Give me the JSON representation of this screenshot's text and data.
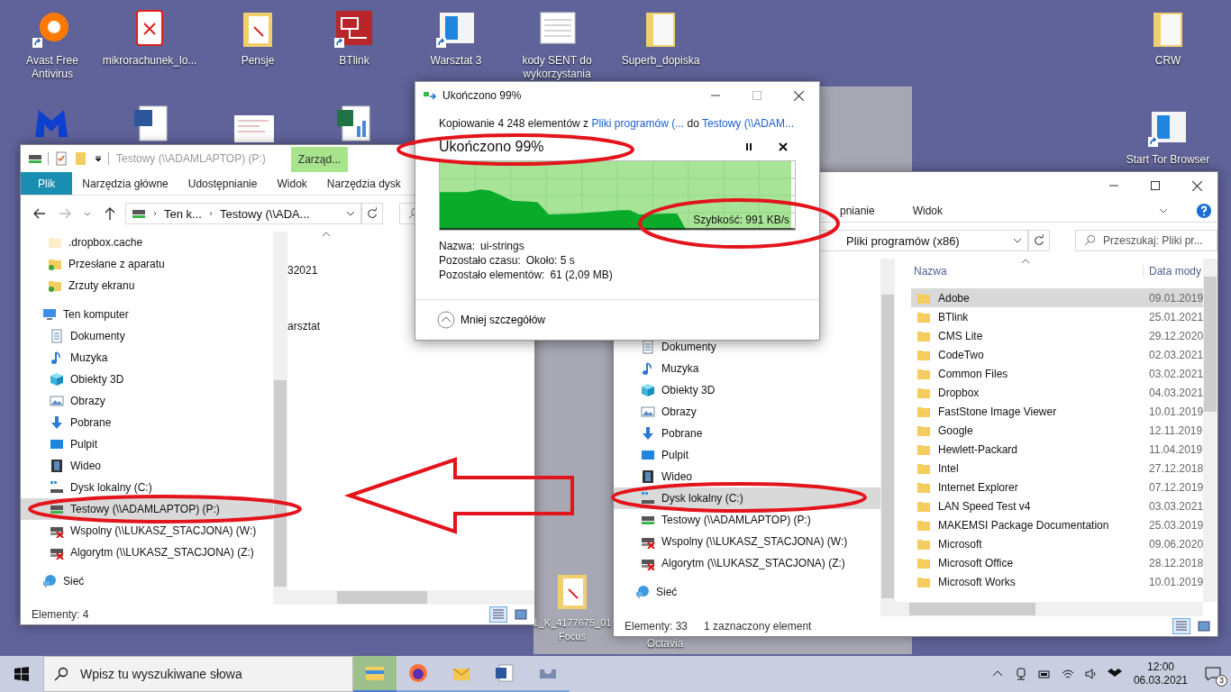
{
  "desktop": {
    "icons": [
      {
        "label": "Avast Free Antivirus",
        "kind": "avast",
        "shortcut": true
      },
      {
        "label": "mikrorachunek_lo...",
        "kind": "pdf",
        "shortcut": false
      },
      {
        "label": "Pensje",
        "kind": "pdf-folder",
        "shortcut": false
      },
      {
        "label": "BTlink",
        "kind": "app",
        "shortcut": true
      },
      {
        "label": "Warsztat 3",
        "kind": "window",
        "shortcut": true
      },
      {
        "label": "kody SENT do wykorzystania",
        "kind": "document",
        "shortcut": false
      },
      {
        "label": "Superb_dopiska",
        "kind": "folder",
        "shortcut": false
      },
      {
        "label": "CRW",
        "kind": "folder",
        "shortcut": false
      },
      {
        "label": "Start Tor Browser",
        "kind": "window",
        "shortcut": true
      },
      {
        "label": "1_K_4177675_01 Focus",
        "kind": "pdf-folder",
        "shortcut": false
      },
      {
        "label": "Octavia",
        "kind": "none"
      }
    ]
  },
  "left_explorer": {
    "title": "Testowy (\\\\ADAMLAPTOP) (P:)",
    "context_tab": "Zarząd...",
    "ribbon_tabs": [
      {
        "label": "Plik",
        "selected": true
      },
      {
        "label": "Narzędzia główne",
        "selected": false
      },
      {
        "label": "Udostępnianie",
        "selected": false
      },
      {
        "label": "Widok",
        "selected": false
      },
      {
        "label": "Narzędzia dysk",
        "selected": false
      }
    ],
    "breadcrumb": [
      "Ten k...",
      "Testowy (\\\\ADA..."
    ],
    "nav_tree": [
      {
        "children": [
          {
            "label": ".dropbox.cache",
            "kind": "folder-plain",
            "selected": false
          },
          {
            "label": "Przesłane z aparatu",
            "kind": "folder-synced",
            "selected": false
          },
          {
            "label": "Zrzuty ekranu",
            "kind": "folder-synced",
            "selected": false
          }
        ]
      },
      {
        "label": "Ten komputer",
        "kind": "pc",
        "selected": false,
        "children": [
          {
            "label": "Dokumenty",
            "kind": "documents",
            "selected": false
          },
          {
            "label": "Muzyka",
            "kind": "music",
            "selected": false
          },
          {
            "label": "Obiekty 3D",
            "kind": "cube",
            "selected": false
          },
          {
            "label": "Obrazy",
            "kind": "pictures",
            "selected": false
          },
          {
            "label": "Pobrane",
            "kind": "download",
            "selected": false
          },
          {
            "label": "Pulpit",
            "kind": "desktop",
            "selected": false
          },
          {
            "label": "Wideo",
            "kind": "video",
            "selected": false
          },
          {
            "label": "Dysk lokalny (C:)",
            "kind": "disk",
            "selected": false
          },
          {
            "label": "Testowy (\\\\ADAMLAPTOP) (P:)",
            "kind": "net-drive",
            "selected": true
          },
          {
            "label": "Wspolny (\\\\LUKASZ_STACJONA) (W:)",
            "kind": "net-drive-off",
            "selected": false
          },
          {
            "label": "Algorytm (\\\\LUKASZ_STACJONA) (Z:)",
            "kind": "net-drive-off",
            "selected": false
          }
        ]
      },
      {
        "label": "Sieć",
        "kind": "network",
        "selected": false
      }
    ],
    "content_fragments": [
      "32021",
      "arsztat"
    ],
    "status": [
      "Elementy: 4"
    ]
  },
  "copy_dialog": {
    "title": "Ukończono 99%",
    "copy_line": {
      "prefix": "Kopiowanie 4 248 elementów z",
      "source": "Pliki programów (...",
      "middle": "do",
      "destination": "Testowy (\\\\ADAM..."
    },
    "heading": "Ukończono 99%",
    "progress": {
      "level": 0.99
    },
    "speed": "Szybkość: 991 KB/s",
    "details": [
      {
        "label": "Nazwa:",
        "value": "ui-strings"
      },
      {
        "label": "Pozostało czasu:",
        "value": "Około: 5 s"
      },
      {
        "label": "Pozostało elementów:",
        "value": "61 (2,09 MB)"
      }
    ],
    "toggle": "Mniej szczegółów"
  },
  "right_explorer": {
    "ribbon_tabs": [
      {
        "label": "pnianie",
        "selected": false
      },
      {
        "label": "Widok",
        "selected": false
      }
    ],
    "address": "Pliki programów (x86)",
    "search": {
      "placeholder": "Przeszukaj: Pliki pr..."
    },
    "nav_tree": [
      {
        "children": [
          {
            "label": "Dokumenty",
            "kind": "documents",
            "selected": false
          },
          {
            "label": "Muzyka",
            "kind": "music",
            "selected": false
          },
          {
            "label": "Obiekty 3D",
            "kind": "cube",
            "selected": false
          },
          {
            "label": "Obrazy",
            "kind": "pictures",
            "selected": false
          },
          {
            "label": "Pobrane",
            "kind": "download",
            "selected": false
          },
          {
            "label": "Pulpit",
            "kind": "desktop",
            "selected": false
          },
          {
            "label": "Wideo",
            "kind": "video",
            "selected": false
          },
          {
            "label": "Dysk lokalny (C:)",
            "kind": "disk",
            "selected": true
          },
          {
            "label": "Testowy (\\\\ADAMLAPTOP) (P:)",
            "kind": "net-drive",
            "selected": false
          },
          {
            "label": "Wspolny (\\\\LUKASZ_STACJONA) (W:)",
            "kind": "net-drive-off",
            "selected": false
          },
          {
            "label": "Algorytm (\\\\LUKASZ_STACJONA) (Z:)",
            "kind": "net-drive-off",
            "selected": false
          }
        ]
      },
      {
        "label": "Sieć",
        "kind": "network",
        "selected": false
      }
    ],
    "columns": [
      "Nazwa",
      "Data mody"
    ],
    "rows": [
      {
        "name": "Adobe",
        "date": "09.01.2019",
        "selected": true
      },
      {
        "name": "BTlink",
        "date": "25.01.2021",
        "selected": false
      },
      {
        "name": "CMS Lite",
        "date": "29.12.2020",
        "selected": false
      },
      {
        "name": "CodeTwo",
        "date": "02.03.2021",
        "selected": false
      },
      {
        "name": "Common Files",
        "date": "03.02.2021",
        "selected": false
      },
      {
        "name": "Dropbox",
        "date": "04.03.2021",
        "selected": false
      },
      {
        "name": "FastStone Image Viewer",
        "date": "10.01.2019",
        "selected": false
      },
      {
        "name": "Google",
        "date": "12.11.2019",
        "selected": false
      },
      {
        "name": "Hewlett-Packard",
        "date": "11.04.2019",
        "selected": false
      },
      {
        "name": "Intel",
        "date": "27.12.2018",
        "selected": false
      },
      {
        "name": "Internet Explorer",
        "date": "07.12.2019",
        "selected": false
      },
      {
        "name": "LAN Speed Test v4",
        "date": "03.03.2021",
        "selected": false
      },
      {
        "name": "MAKEMSI Package Documentation",
        "date": "25.03.2019",
        "selected": false
      },
      {
        "name": "Microsoft",
        "date": "09.06.2020",
        "selected": false
      },
      {
        "name": "Microsoft Office",
        "date": "28.12.2018",
        "selected": false
      },
      {
        "name": "Microsoft Works",
        "date": "10.01.2019",
        "selected": false
      }
    ],
    "status": [
      "Elementy: 33",
      "1 zaznaczony element"
    ]
  },
  "taskbar": {
    "search": {
      "placeholder": "Wpisz tu wyszukiwane słowa"
    },
    "apps": [
      {
        "kind": "explorer",
        "active": true
      },
      {
        "kind": "firefox",
        "active": false
      },
      {
        "kind": "mail",
        "active": false
      },
      {
        "kind": "word",
        "active": false
      },
      {
        "kind": "tool",
        "active": false
      }
    ],
    "time": "12:00",
    "date": "06.03.2021",
    "notifications": "3"
  }
}
